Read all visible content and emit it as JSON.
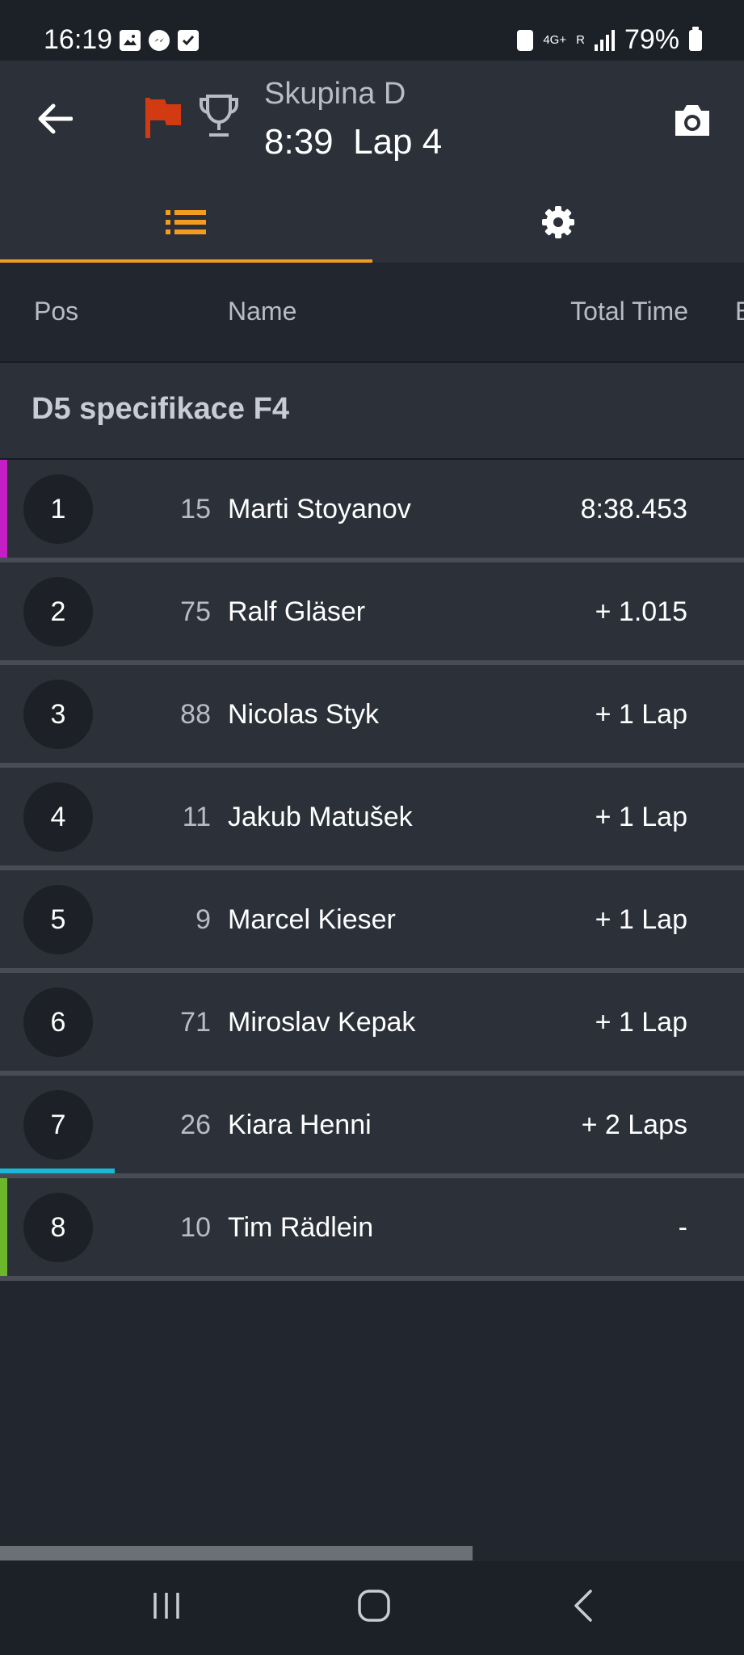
{
  "status_bar": {
    "time": "16:19",
    "network": "4G+",
    "roaming": "R",
    "battery": "79%"
  },
  "app_bar": {
    "session_name": "Skupina D",
    "elapsed": "8:39",
    "lap": "Lap 4",
    "flag_color": "#d23a12"
  },
  "tabs": [
    {
      "icon": "list-icon",
      "active": true
    },
    {
      "icon": "gear-icon",
      "active": false
    }
  ],
  "columns": {
    "pos": "Pos",
    "name": "Name",
    "total_time": "Total Time",
    "extra": "B"
  },
  "group": {
    "title": "D5 specifikace F4"
  },
  "results": [
    {
      "pos": "1",
      "number": "15",
      "name": "Marti Stoyanov",
      "total": "8:38.453",
      "marker": "#c41fc4"
    },
    {
      "pos": "2",
      "number": "75",
      "name": "Ralf Gläser",
      "total": "+ 1.015"
    },
    {
      "pos": "3",
      "number": "88",
      "name": "Nicolas Styk",
      "total": "+ 1 Lap"
    },
    {
      "pos": "4",
      "number": "11",
      "name": "Jakub Matušek",
      "total": "+ 1 Lap"
    },
    {
      "pos": "5",
      "number": "9",
      "name": "Marcel Kieser",
      "total": "+ 1 Lap"
    },
    {
      "pos": "6",
      "number": "71",
      "name": "Miroslav Kepak",
      "total": "+ 1 Lap"
    },
    {
      "pos": "7",
      "number": "26",
      "name": "Kiara Henni",
      "total": "+ 2 Laps",
      "accent": "#1ab8d8"
    },
    {
      "pos": "8",
      "number": "10",
      "name": "Tim Rädlein",
      "total": "-",
      "marker": "#6db82a"
    }
  ],
  "colors": {
    "accent": "#f39c22",
    "background": "#22262e",
    "surface": "#2b3039"
  }
}
